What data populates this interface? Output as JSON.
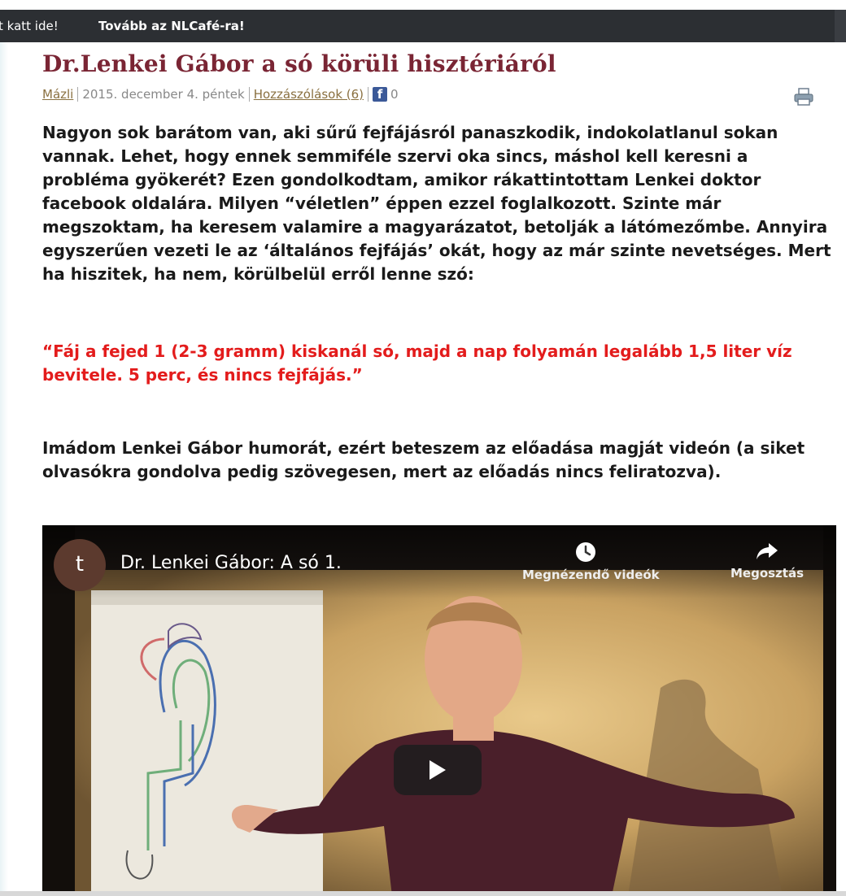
{
  "topbar": {
    "text": "t katt ide!",
    "link": "Tovább az NLCafé-ra!"
  },
  "article": {
    "title": "Dr.Lenkei Gábor a só körüli hisztériáról",
    "meta": {
      "author": "Mázli",
      "date": "2015. december 4. péntek",
      "comments": "Hozzászólások (6)",
      "fb_icon": "f",
      "fb_count": "0"
    },
    "paragraph1": "Nagyon sok barátom van, aki sűrű fejfájásról panaszkodik, indokolatlanul sokan vannak. Lehet, hogy ennek semmiféle szervi oka sincs, máshol kell keresni a probléma gyökerét? Ezen gondolkodtam, amikor rákattintottam Lenkei doktor facebook oldalára. Milyen “véletlen” éppen ezzel foglalkozott. Szinte már megszoktam, ha keresem valamire a magyarázatot, betolják a látómezőmbe. Annyira egyszerűen vezeti le az ‘általános fejfájás’ okát, hogy az már szinte nevetséges. Mert ha hiszitek, ha nem, körülbelül erről lenne szó:",
    "quote": "“Fáj a fejed 1 (2-3 gramm) kiskanál só, majd a nap folyamán legalább 1,5 liter víz bevitele.  5 perc, és nincs fejfájás.”",
    "paragraph2": "Imádom Lenkei Gábor humorát, ezért beteszem az előadása magját videón (a siket olvasókra gondolva pedig szövegesen, mert az előadás nincs feliratozva)."
  },
  "video": {
    "channel_initial": "t",
    "title": "Dr. Lenkei Gábor: A só 1.",
    "watch_later": "Megnézendő videók",
    "share": "Megosztás"
  },
  "colors": {
    "title": "#7a2534",
    "quote": "#e31c1c",
    "topbar": "#2c2f33",
    "facebook": "#3b5998"
  },
  "icons": [
    "facebook-icon",
    "print-icon",
    "clock-icon",
    "share-arrow-icon",
    "play-icon"
  ]
}
